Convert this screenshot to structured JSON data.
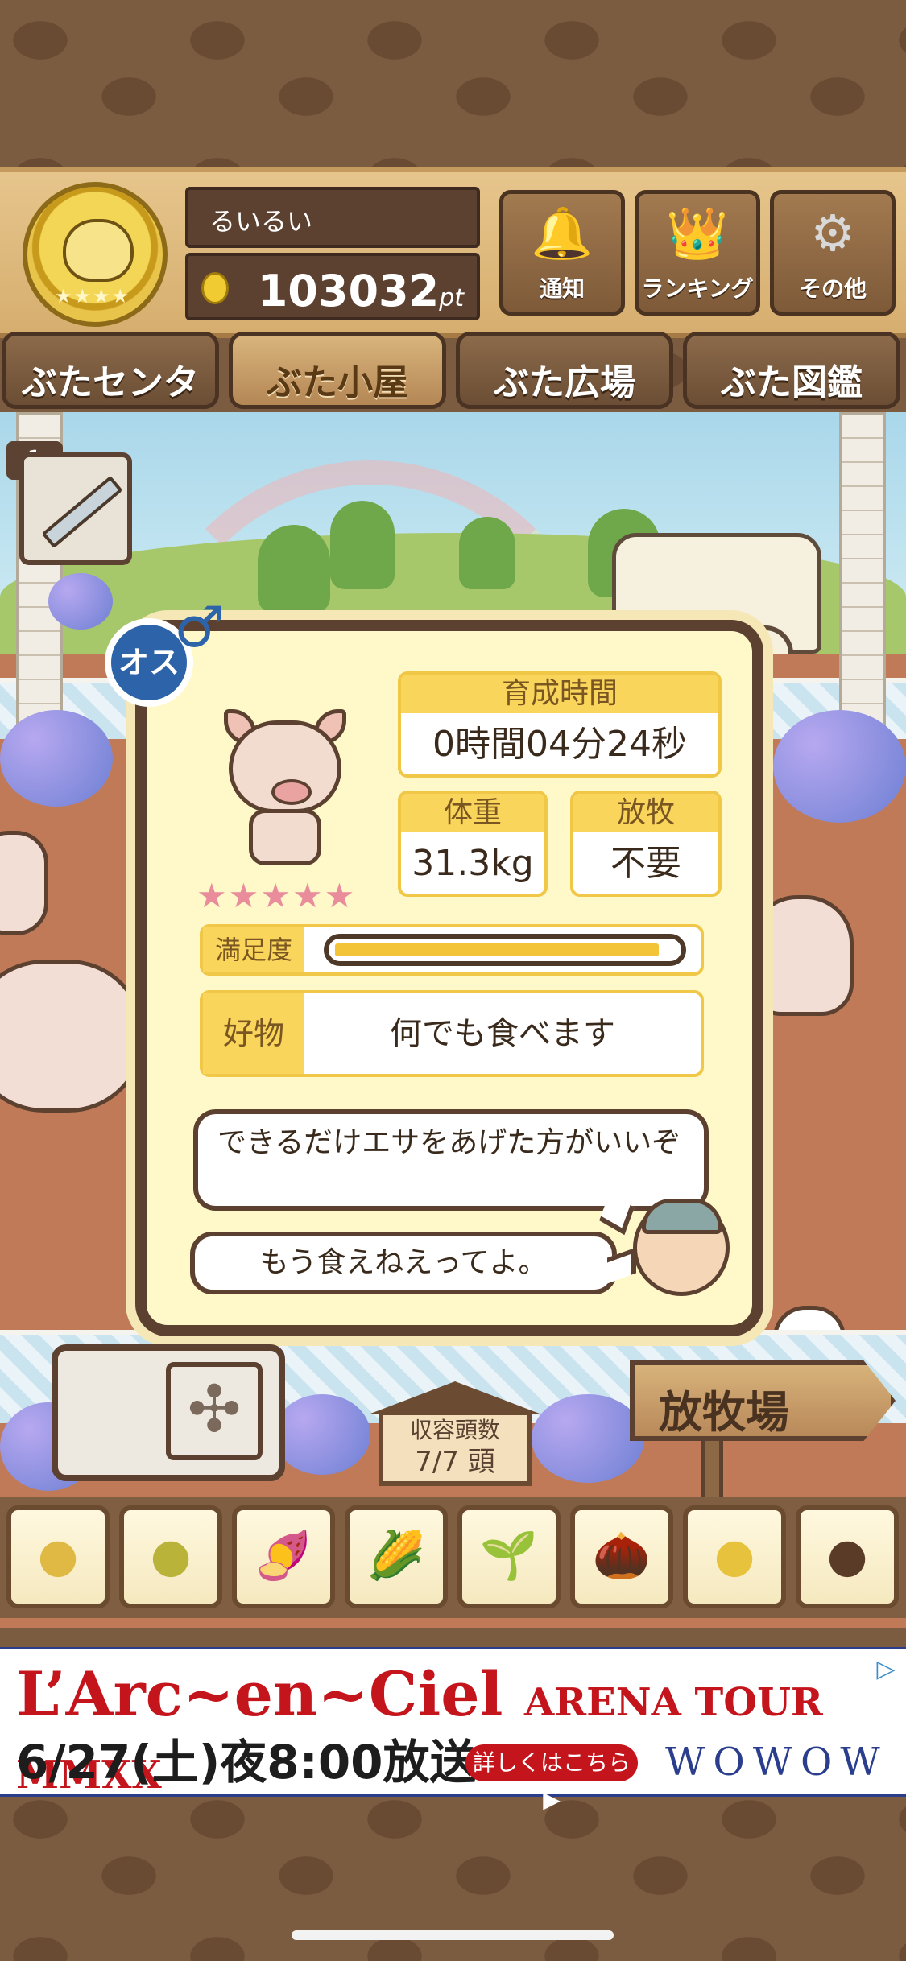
{
  "header": {
    "player_name": "るいるい",
    "points": "103032",
    "points_unit": "pt",
    "rank_stars": "★★★★",
    "buttons": [
      {
        "icon": "bell-icon",
        "glyph": "🔔",
        "label": "通知"
      },
      {
        "icon": "crown-icon",
        "glyph": "👑",
        "label": "ランキング"
      },
      {
        "icon": "gear-icon",
        "glyph": "⚙",
        "label": "その他"
      }
    ]
  },
  "nav": {
    "tabs": [
      {
        "label": "ぶたセンター",
        "active": false
      },
      {
        "label": "ぶた小屋",
        "active": true
      },
      {
        "label": "ぶた広場",
        "active": false
      },
      {
        "label": "ぶた図鑑",
        "active": false
      }
    ]
  },
  "item": {
    "count": "1",
    "icon": "syringe-icon"
  },
  "pig_info": {
    "gender_label": "オス",
    "gender_symbol": "♂",
    "rarity_stars": "★★★★★",
    "raising_time_label": "育成時間",
    "raising_time_value": "0時間04分24秒",
    "weight_label": "体重",
    "weight_value": "31.3kg",
    "grazing_label": "放牧",
    "grazing_value": "不要",
    "satisfaction_label": "満足度",
    "satisfaction_level": 0.98,
    "favorite_label": "好物",
    "favorite_value": "何でも食べます",
    "advice_text": "できるだけエサをあげた方がいいぞ",
    "pig_quote": "もう食えねえってよ。"
  },
  "barn": {
    "capacity_label": "収容頭数",
    "capacity_value": "7/7 頭",
    "pasture_sign": "放牧場"
  },
  "food_items": [
    {
      "icon": "grain-pile-icon",
      "glyph": "●"
    },
    {
      "icon": "mixed-grain-icon",
      "glyph": "●"
    },
    {
      "icon": "sweet-potato-icon",
      "glyph": "🍠"
    },
    {
      "icon": "corn-icon",
      "glyph": "🌽"
    },
    {
      "icon": "soybean-icon",
      "glyph": "🌱"
    },
    {
      "icon": "acorn-icon",
      "glyph": "🌰"
    },
    {
      "icon": "bean-plate-icon",
      "glyph": "●"
    },
    {
      "icon": "truffle-plate-icon",
      "glyph": "●"
    }
  ],
  "ad": {
    "title": "L’Arc~en~Ciel",
    "subtitle": "ARENA TOUR MMXX",
    "date": "6/27(土)夜8:00放送",
    "button": "詳しくはこちら▶",
    "brand": "WOWOW",
    "ad_choice": "▷"
  },
  "colors": {
    "panel_bg": "#fff9c9",
    "accent_yellow": "#fad55b",
    "wood_dark": "#5c4131",
    "ad_red": "#c4141c",
    "ad_blue": "#2a3e8d"
  }
}
